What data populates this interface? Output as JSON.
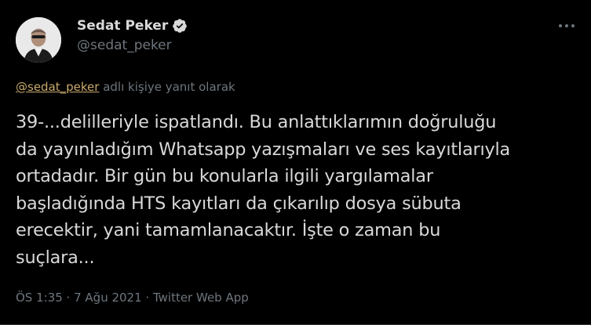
{
  "author": {
    "display_name": "Sedat Peker",
    "handle": "@sedat_peker",
    "verified": true
  },
  "reply_context": {
    "handle": "@sedat_peker",
    "suffix": " adlı kişiye yanıt olarak"
  },
  "tweet": {
    "text_lines": [
      "39-...delilleriyle ispatlandı. Bu anlattıklarımın doğruluğu",
      "da yayınladığım Whatsapp yazışmaları ve ses kayıtlarıyla",
      "ortadadır. Bir gün bu konularla ilgili yargılamalar",
      "başladığında HTS kayıtları da çıkarılıp dosya sübuta",
      "erecektir, yani tamamlanacaktır. İşte o zaman bu",
      "suçlara..."
    ]
  },
  "meta": {
    "time": "ÖS 1:35",
    "separator": " · ",
    "date": "7 Ağu 2021",
    "source": "Twitter Web App"
  },
  "colors": {
    "background": "#000000",
    "text": "#d9d9d9",
    "secondary_text": "#6e767d",
    "reply_link": "#c8a96a",
    "verified_badge": "#d9d9d9"
  },
  "icons": {
    "verified": "verified-badge-icon",
    "more": "more-options-icon"
  }
}
